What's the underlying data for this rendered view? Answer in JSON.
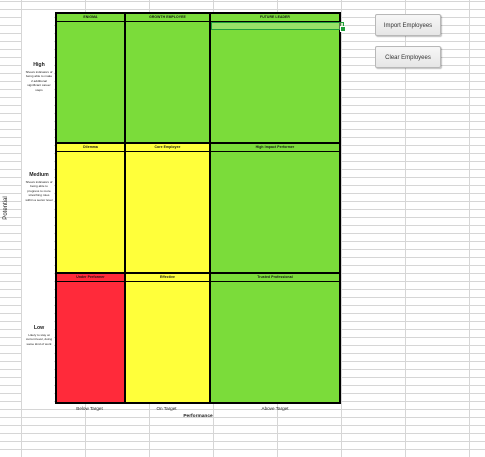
{
  "axis": {
    "potential": "Potential",
    "performance": "Performance",
    "columns": [
      "Below Target",
      "On Target",
      "Above Target"
    ]
  },
  "rows": [
    {
      "level": "High",
      "description": "Shows indicators of being able to make 2 additional significant career steps"
    },
    {
      "level": "Medium",
      "description": "Shows indicators of being able to progress to more stretching roles within a sector level"
    },
    {
      "level": "Low",
      "description": "Likely to stay at current level, doing same kind of work"
    }
  ],
  "cells": [
    {
      "label": "ENIGMA",
      "color": "#7bdc3a"
    },
    {
      "label": "GROWTH EMPLOYEE",
      "color": "#7bdc3a"
    },
    {
      "label": "FUTURE LEADER",
      "color": "#7bdc3a"
    },
    {
      "label": "Dilemma",
      "color": "#ffff3a"
    },
    {
      "label": "Core Employee",
      "color": "#ffff3a"
    },
    {
      "label": "High Impact Performer",
      "color": "#7bdc3a"
    },
    {
      "label": "Under Performer",
      "color": "#ff2a3a"
    },
    {
      "label": "Effective",
      "color": "#ffff3a"
    },
    {
      "label": "Trusted Professional",
      "color": "#7bdc3a"
    }
  ],
  "buttons": {
    "import": "Import Employees",
    "clear": "Clear Employees"
  }
}
